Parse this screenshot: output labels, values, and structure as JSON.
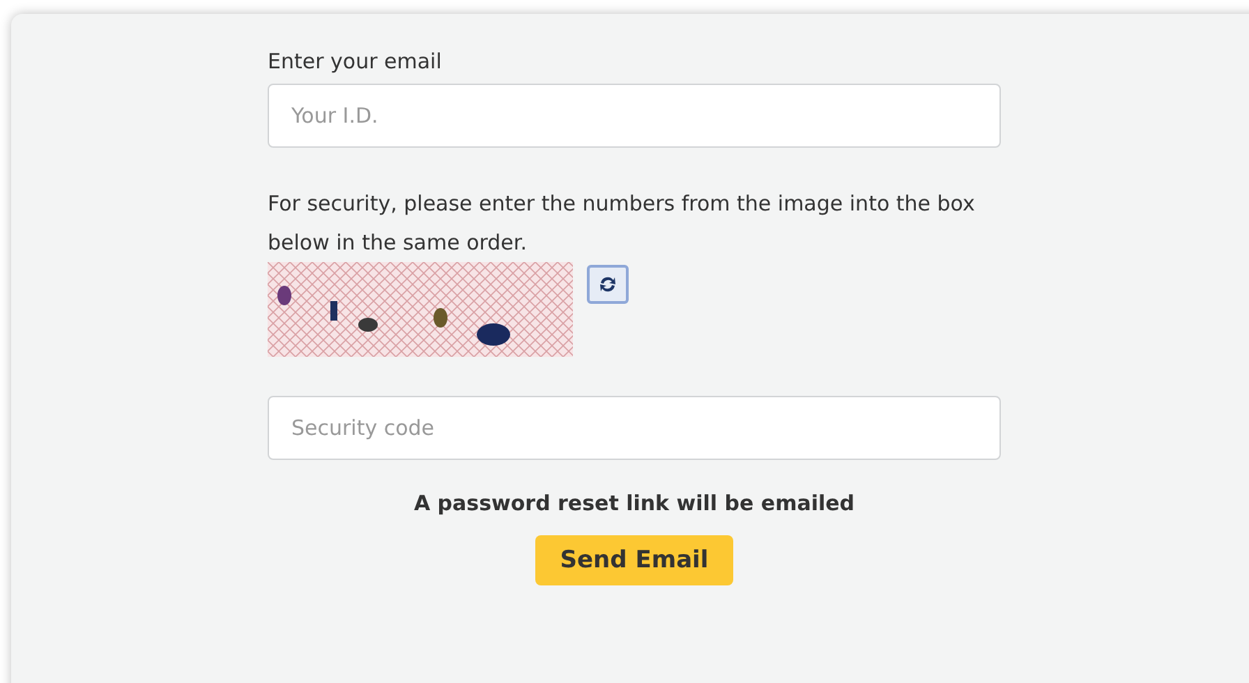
{
  "email_label": "Enter your email",
  "email_field": {
    "placeholder": "Your I.D."
  },
  "security_text": "For security, please enter the numbers from the image into the box below in the same order.",
  "code_field": {
    "placeholder": "Security code"
  },
  "notice": "A password reset link will be emailed",
  "submit_button": "Send Email"
}
